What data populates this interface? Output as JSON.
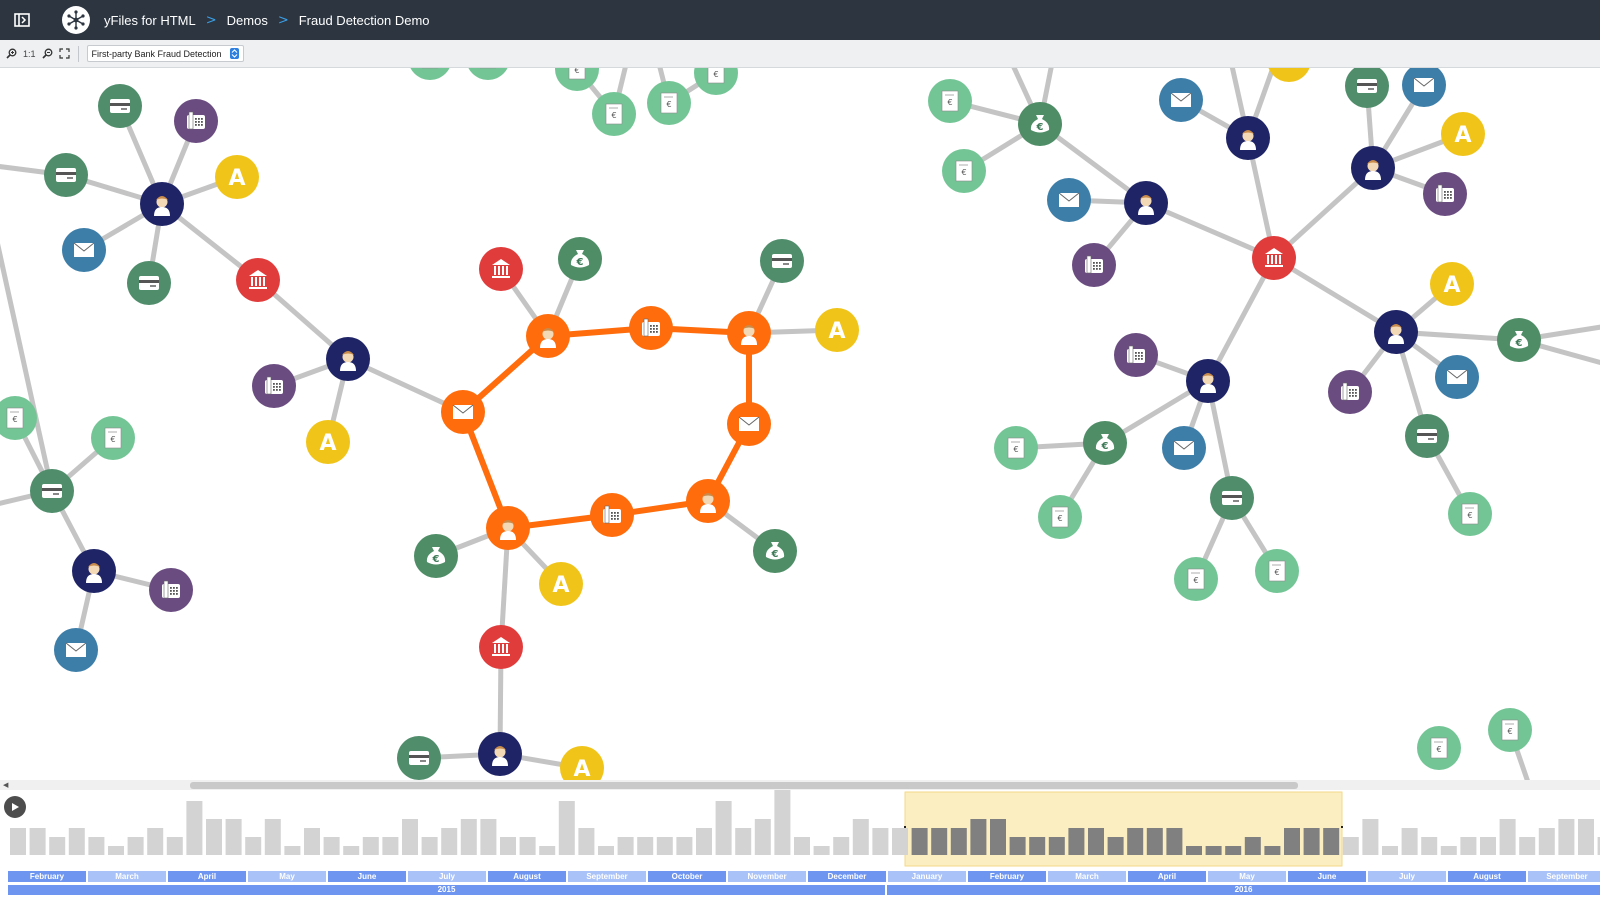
{
  "header": {
    "product": "yFiles for HTML",
    "breadcrumb": [
      "Demos",
      "Fraud Detection Demo"
    ]
  },
  "toolbar": {
    "one_to_one_label": "1:1",
    "scenario_select": "First-party Bank Fraud Detection"
  },
  "timeline": {
    "months_2015": [
      "February",
      "March",
      "April",
      "May",
      "June",
      "July",
      "August",
      "September",
      "October",
      "November",
      "December"
    ],
    "months_2016": [
      "January",
      "February",
      "March",
      "April",
      "May",
      "June",
      "July",
      "August",
      "September"
    ],
    "years": [
      "2015",
      "2016"
    ],
    "selection": {
      "from": "January 2016",
      "to": "June 2016"
    },
    "bars_unselected": [
      3,
      3,
      2,
      3,
      2,
      1,
      2,
      3,
      2,
      6,
      4,
      4,
      2,
      4,
      1,
      3,
      2,
      1,
      2,
      2,
      4,
      2,
      3,
      4,
      4,
      2,
      2,
      1,
      6,
      3,
      1,
      2,
      2,
      2,
      2,
      3,
      6,
      3,
      4,
      8,
      2,
      1,
      2,
      4,
      3,
      3,
      2,
      3,
      3,
      3,
      4,
      3,
      3,
      5,
      2,
      3
    ],
    "bars_selected": [
      3,
      3,
      3,
      4,
      4,
      2,
      2,
      2,
      3,
      3,
      2,
      3,
      3,
      3,
      1,
      1,
      1,
      2,
      1,
      3
    ]
  },
  "colors": {
    "header_bg": "#2c3540",
    "account_holder": "#1f2466",
    "bank_branch": "#e13c3c",
    "credit_card": "#4f8d6b",
    "phone": "#6a4c80",
    "email": "#3d7ea9",
    "address": "#f0c419",
    "payment": "#74c596",
    "money": "#4e8d66",
    "fraud_ring": "#ff6c0c",
    "edge": "#c4c4c4"
  },
  "legend_icons": [
    "account-holder-icon",
    "bank-branch-icon",
    "credit-card-icon",
    "phone-icon",
    "email-icon",
    "address-icon",
    "payment-icon",
    "money-icon"
  ]
}
